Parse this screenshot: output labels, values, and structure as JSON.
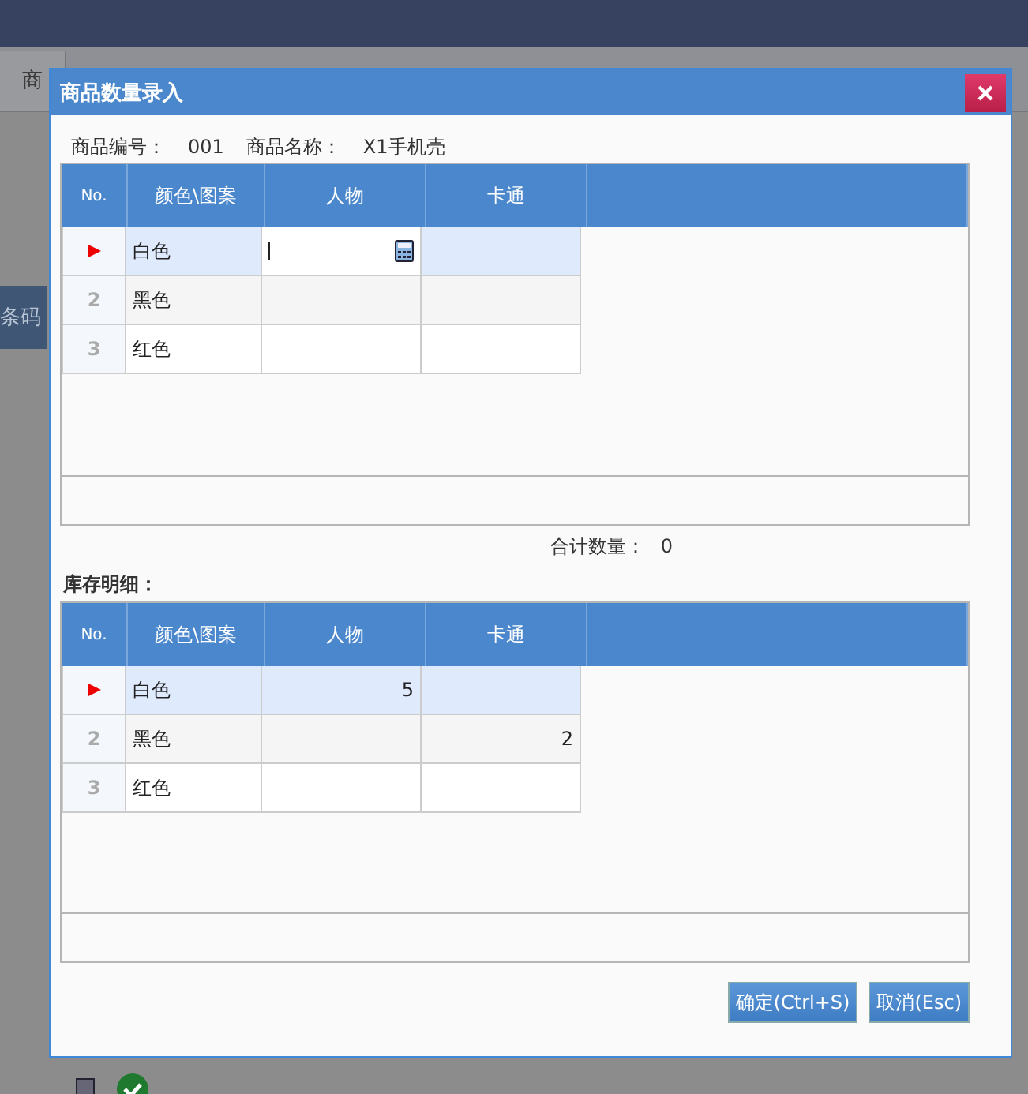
{
  "background": {
    "tab": "商",
    "side_label": "条码"
  },
  "dialog": {
    "title": "商品数量录入",
    "info": [
      {
        "label": "商品编号：",
        "value": "001"
      },
      {
        "label": "商品名称：",
        "value": "X1手机壳"
      }
    ],
    "entry_grid": {
      "columns": [
        "No.",
        "颜色\\图案",
        "人物",
        "卡通"
      ],
      "rows": [
        {
          "name": "白色",
          "selected": true,
          "cells": [
            {
              "editing": true
            },
            {
              "editing": false
            }
          ]
        },
        {
          "no": "2",
          "name": "黑色",
          "selected": false,
          "cells": [
            {
              "editing": false
            },
            {
              "editing": false
            }
          ]
        },
        {
          "no": "3",
          "name": "红色",
          "selected": false,
          "cells": [
            {
              "editing": false
            },
            {
              "editing": false
            }
          ]
        }
      ]
    },
    "total": {
      "label": "合计数量：",
      "value": "0"
    },
    "stock_title": "库存明细：",
    "stock_grid": {
      "columns": [
        "No.",
        "颜色\\图案",
        "人物",
        "卡通"
      ],
      "rows": [
        {
          "name": "白色",
          "selected": true,
          "cells": [
            {
              "value": "5",
              "editing": false
            },
            {
              "editing": false
            }
          ]
        },
        {
          "no": "2",
          "name": "黑色",
          "selected": false,
          "cells": [
            {
              "editing": false
            },
            {
              "value": "2",
              "editing": false
            }
          ]
        },
        {
          "no": "3",
          "name": "红色",
          "selected": false,
          "cells": [
            {
              "editing": false
            },
            {
              "editing": false
            }
          ]
        }
      ]
    },
    "buttons": [
      "确定(Ctrl+S)",
      "取消(Esc)"
    ]
  }
}
